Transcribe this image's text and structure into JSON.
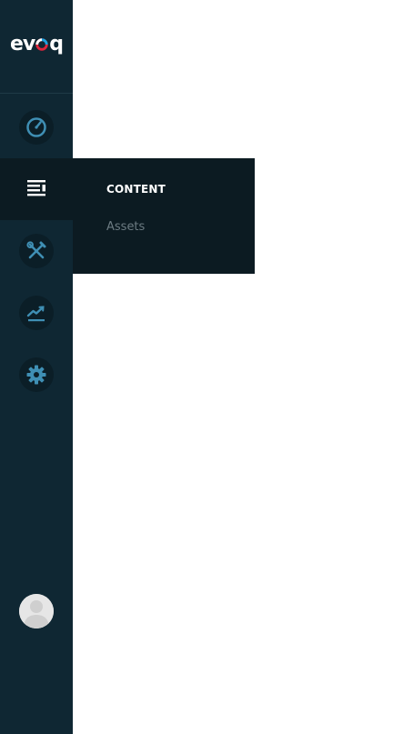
{
  "brand": {
    "logo_text_left": "ev",
    "logo_text_right": "q",
    "logo_colors": [
      "#ffffff",
      "#e0253c",
      "#1aa3e0"
    ]
  },
  "sidebar": {
    "items": [
      {
        "name": "dashboard",
        "icon": "gauge-icon",
        "active": false
      },
      {
        "name": "content",
        "icon": "document-lines-icon",
        "active": true
      },
      {
        "name": "tools",
        "icon": "wrench-screwdriver-icon",
        "active": false
      },
      {
        "name": "analytics",
        "icon": "line-chart-icon",
        "active": false
      },
      {
        "name": "settings",
        "icon": "gear-icon",
        "active": false
      }
    ],
    "icon_color": "#3f8fb4",
    "background": "#0f2733"
  },
  "flyout": {
    "title": "CONTENT",
    "items": [
      "Assets"
    ]
  },
  "user": {
    "avatar_icon": "user-silhouette-icon"
  }
}
